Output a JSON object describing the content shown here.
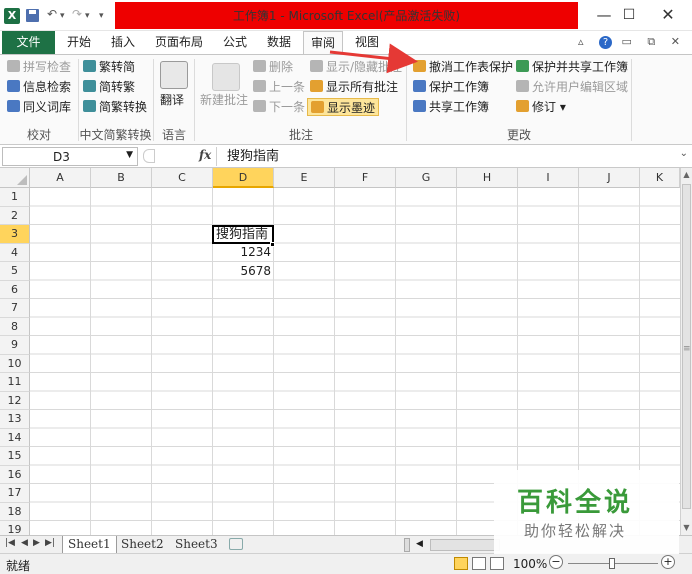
{
  "titlebar": {
    "logo": "X",
    "title": "工作簿1 - Microsoft Excel(产品激活失败)",
    "undo": "↶",
    "redo": "↷",
    "dropdown": "▾",
    "minimize": "—",
    "maximize": "☐",
    "close": "✕"
  },
  "tabs": {
    "file": "文件",
    "items": [
      "开始",
      "插入",
      "页面布局",
      "公式",
      "数据",
      "审阅",
      "视图"
    ],
    "right_icons": "▵ ? ▭ ⧉ ✕"
  },
  "ribbon": {
    "proofing": {
      "spellcheck": "拼写检查",
      "research": "信息检索",
      "thesaurus": "同义词库",
      "label": "校对"
    },
    "chinese_convert": {
      "to_simplified": "繁转简",
      "to_traditional": "简转繁",
      "convert": "简繁转换",
      "label": "中文简繁转换"
    },
    "language": {
      "translate": "翻译",
      "label": "语言"
    },
    "comments": {
      "new_comment": "新建批注",
      "delete": "删除",
      "previous": "上一条",
      "next": "下一条",
      "show_hide": "显示/隐藏批注",
      "show_all": "显示所有批注",
      "show_ink": "显示墨迹",
      "label": "批注"
    },
    "changes": {
      "unprotect_sheet": "撤消工作表保护",
      "protect_workbook": "保护工作簿",
      "share_workbook": "共享工作簿",
      "protect_share": "保护并共享工作簿",
      "allow_edit_ranges": "允许用户编辑区域",
      "track_changes": "修订 ▾",
      "label": "更改"
    }
  },
  "formula_bar": {
    "name_box": "D3",
    "fx": "fx",
    "content": "搜狗指南"
  },
  "grid": {
    "columns": [
      "A",
      "B",
      "C",
      "D",
      "E",
      "F",
      "G",
      "H",
      "I",
      "J",
      "K"
    ],
    "rows": [
      "1",
      "2",
      "3",
      "4",
      "5",
      "6",
      "7",
      "8",
      "9",
      "10",
      "11",
      "12",
      "13",
      "14",
      "15",
      "16",
      "17",
      "18",
      "19"
    ],
    "active_cell": "D3",
    "cells": {
      "D3": "搜狗指南",
      "D4": "1234",
      "D5": "5678"
    }
  },
  "sheets": [
    "Sheet1",
    "Sheet2",
    "Sheet3"
  ],
  "status": {
    "ready": "就绪",
    "zoom": "100%",
    "minus": "−",
    "plus": "+"
  },
  "watermark": {
    "title": "百科全说",
    "subtitle": "助你轻松解决"
  },
  "colors": {
    "file_tab": "#1e7145",
    "title_band": "#ee0000",
    "selection_header": "#ffd45c",
    "arrow": "#e53935"
  }
}
